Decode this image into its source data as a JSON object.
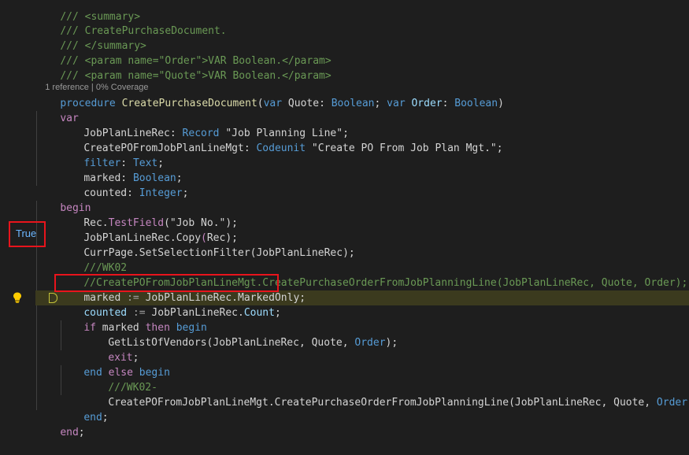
{
  "codelens": "1 reference | 0% Coverage",
  "debug_value": "True",
  "lines": {
    "l1": [
      "///",
      " <summary>"
    ],
    "l2": [
      "/// CreatePurchaseDocument."
    ],
    "l3": [
      "/// </summary>"
    ],
    "l4": [
      "/// <param name=\"Order\">VAR Boolean.</param>"
    ],
    "l5": [
      "/// <param name=\"Quote\">VAR Boolean.</param>"
    ],
    "l6": [
      "procedure",
      " CreatePurchaseDocument",
      "(",
      "var",
      " Quote",
      ": ",
      "Boolean",
      "; ",
      "var",
      " Order",
      ": ",
      "Boolean",
      ")"
    ],
    "l7": [
      "var"
    ],
    "l8": [
      "JobPlanLineRec",
      ": ",
      "Record",
      " ",
      "\"Job Planning Line\"",
      ";"
    ],
    "l9": [
      "CreatePOFromJobPlanLineMgt",
      ": ",
      "Codeunit",
      " ",
      "\"Create PO From Job Plan Mgt.\"",
      ";"
    ],
    "l10": [
      "filter",
      ": ",
      "Text",
      ";"
    ],
    "l11": [
      "marked",
      ": ",
      "Boolean",
      ";"
    ],
    "l12": [
      "counted",
      ": ",
      "Integer",
      ";"
    ],
    "l13": [
      "begin"
    ],
    "l14": [
      "Rec",
      ".",
      "TestField",
      "(",
      "\"Job No.\"",
      ");"
    ],
    "l15": [
      "JobPlanLineRec",
      ".",
      "Copy",
      "(",
      "Rec",
      ");"
    ],
    "l16": [
      "CurrPage",
      ".",
      "SetSelectionFilter",
      "(",
      "JobPlanLineRec",
      ");"
    ],
    "l17": [
      "///WK02"
    ],
    "l18": [
      "//CreatePOFromJobPlanLineMgt.CreatePurchaseOrderFromJobPlanningLine(JobPlanLineRec, Quote, Order);"
    ],
    "l19": [
      "marked",
      " := ",
      "JobPlanLineRec",
      ".",
      "MarkedOnly",
      ";"
    ],
    "l20": [
      "counted",
      " := ",
      "JobPlanLineRec",
      ".",
      "Count",
      ";"
    ],
    "l21": [
      "if",
      " marked ",
      "then",
      " ",
      "begin"
    ],
    "l22": [
      "GetListOfVendors",
      "(",
      "JobPlanLineRec",
      ", ",
      "Quote",
      ", ",
      "Order",
      ");"
    ],
    "l23": [
      "exit",
      ";"
    ],
    "l24": [
      "end",
      " ",
      "else",
      " ",
      "begin"
    ],
    "l25": [
      "///WK02-"
    ],
    "l26": [
      "CreatePOFromJobPlanLineMgt",
      ".",
      "CreatePurchaseOrderFromJobPlanningLine",
      "(",
      "JobPlanLineRec",
      ", ",
      "Quote",
      ", ",
      "Order",
      ");"
    ],
    "l27": [
      "end",
      ";"
    ],
    "l28": [
      "end",
      ";"
    ]
  },
  "colors": {
    "background": "#1e1e1e",
    "comment": "#6a9955",
    "keyword": "#569cd6",
    "function": "#dcdcaa",
    "string": "#ce9178",
    "variable": "#9cdcfe",
    "highlight_box": "#e8141c",
    "active_line": "#3b3a1e"
  },
  "icons": [
    "lightbulb-icon",
    "breakpoint-marker-icon"
  ]
}
